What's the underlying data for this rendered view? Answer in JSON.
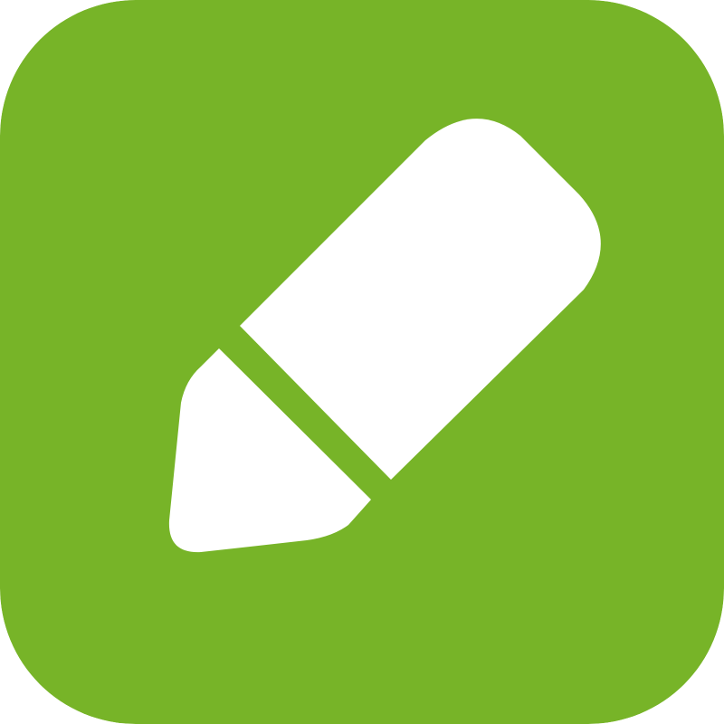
{
  "icon": {
    "name": "pencil-icon",
    "background_color": "#77B428",
    "glyph_color": "#FFFFFF"
  }
}
